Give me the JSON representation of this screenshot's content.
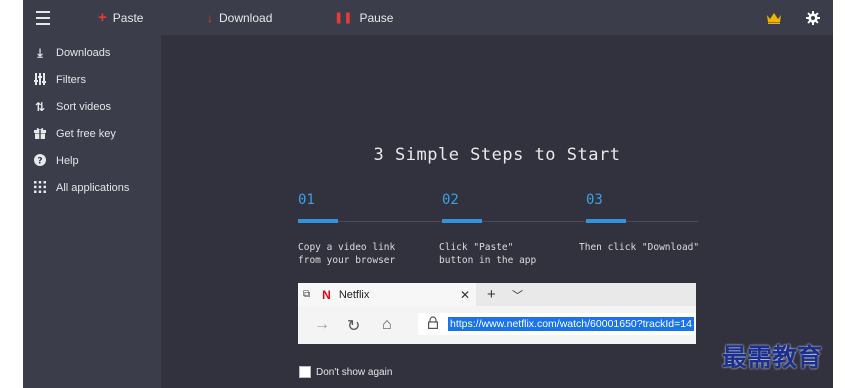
{
  "toolbar": {
    "paste_label": "Paste",
    "download_label": "Download",
    "pause_label": "Pause",
    "icons": [
      "menu-icon",
      "plus-icon",
      "download-arrow-icon",
      "pause-icon",
      "crown-icon",
      "gear-icon"
    ],
    "accent_color": "#e63b36",
    "crown_color": "#f0b400"
  },
  "sidebar": {
    "items": [
      {
        "label": "Downloads",
        "icon": "download-icon"
      },
      {
        "label": "Filters",
        "icon": "filters-icon"
      },
      {
        "label": "Sort videos",
        "icon": "sort-icon"
      },
      {
        "label": "Get free key",
        "icon": "gift-icon"
      },
      {
        "label": "Help",
        "icon": "help-icon"
      },
      {
        "label": "All applications",
        "icon": "grid-icon"
      }
    ]
  },
  "main": {
    "heading": "3 Simple Steps to Start",
    "steps": [
      {
        "number": "01",
        "text": "Copy a video link\nfrom your browser"
      },
      {
        "number": "02",
        "text": "Click \"Paste\"\nbutton in the app"
      },
      {
        "number": "03",
        "text": "Then click \"Download\""
      }
    ],
    "browser": {
      "tab_title": "Netflix",
      "url": "https://www.netflix.com/watch/60001650?trackId=14"
    },
    "dont_show_label": "Don't show again"
  },
  "watermark": "最需教育"
}
